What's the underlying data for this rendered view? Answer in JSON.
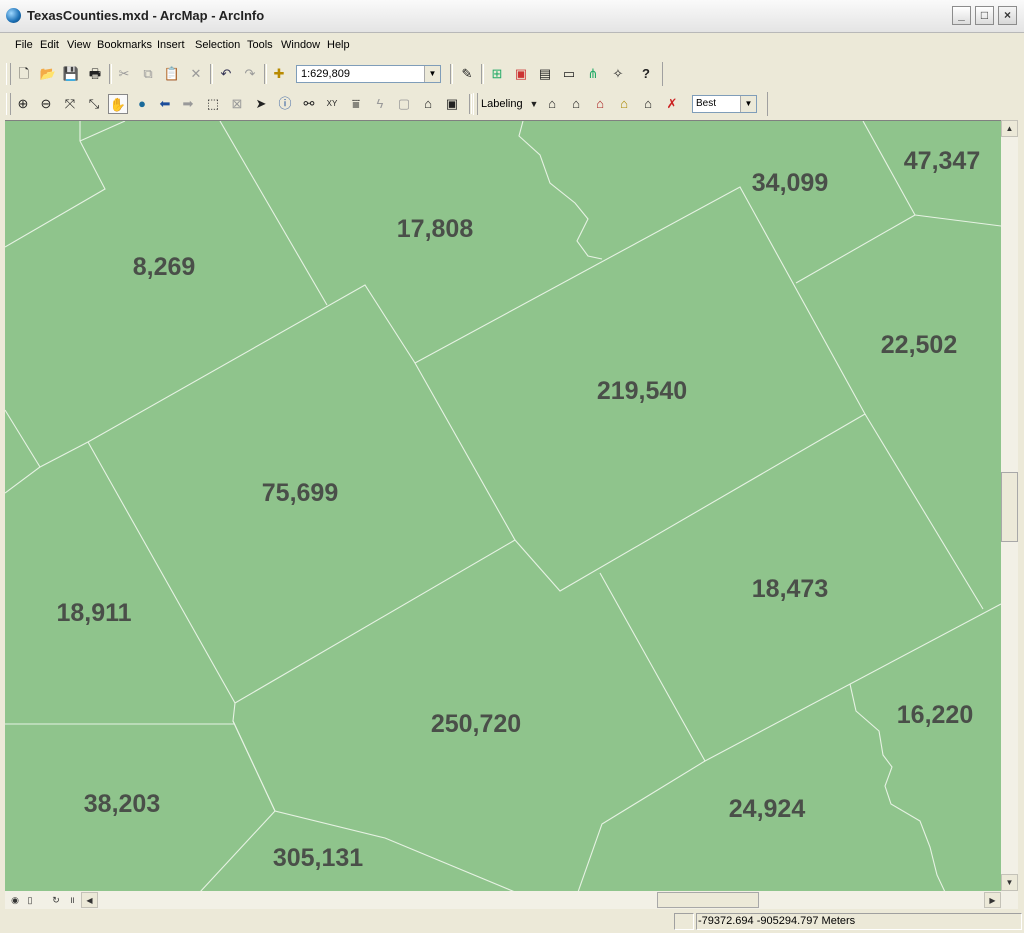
{
  "window": {
    "title": "TexasCounties.mxd - ArcMap - ArcInfo",
    "minimize": "_",
    "maximize": "□",
    "close": "×"
  },
  "menu": {
    "items": [
      "File",
      "Edit",
      "View",
      "Bookmarks",
      "Insert",
      "Selection",
      "Tools",
      "Window",
      "Help"
    ]
  },
  "toolbar": {
    "scale": "1:629,809",
    "labeling": "Labeling",
    "label_placement": "Best"
  },
  "map": {
    "fill_color": "#8fc48c",
    "boundary_color": "#e6f2e3",
    "label_color": "#4a4f49",
    "labels": [
      "47,347",
      "34,099",
      "17,808",
      "8,269",
      "22,502",
      "219,540",
      "75,699",
      "18,911",
      "18,473",
      "250,720",
      "16,220",
      "38,203",
      "24,924",
      "305,131"
    ]
  },
  "status": {
    "coordinates": "-79372.694  -905294.797 Meters"
  }
}
